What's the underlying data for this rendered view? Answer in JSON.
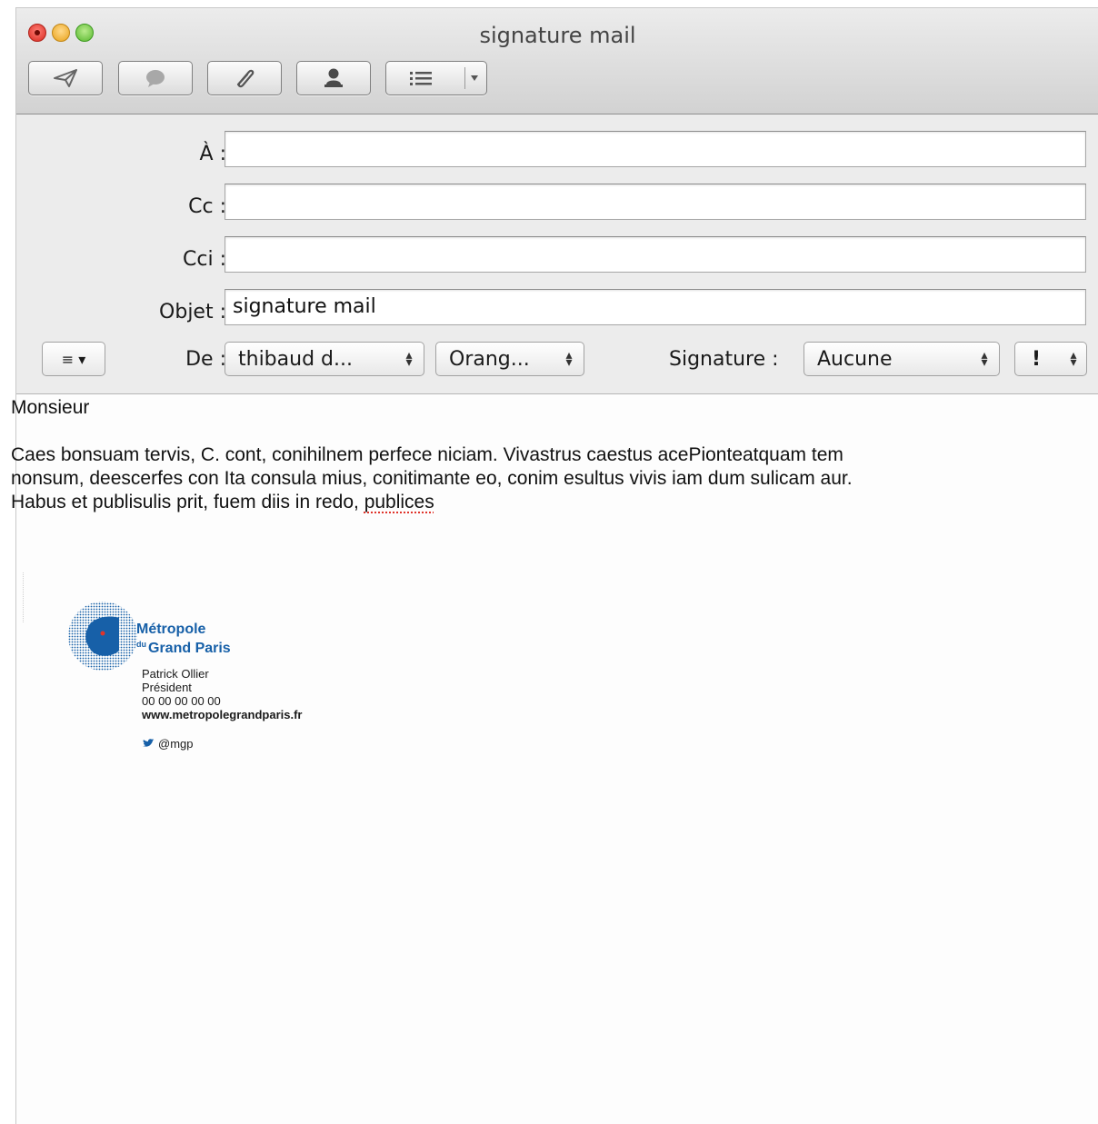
{
  "window": {
    "title": "signature mail"
  },
  "toolbar": {
    "buttons": [
      {
        "icon": "send-icon"
      },
      {
        "icon": "chat-icon"
      },
      {
        "icon": "paperclip-icon"
      },
      {
        "icon": "contact-icon"
      },
      {
        "icon": "list-format-icon"
      }
    ]
  },
  "header": {
    "to_label": "À :",
    "to_value": "",
    "cc_label": "Cc :",
    "cc_value": "",
    "bcc_label": "Cci :",
    "bcc_value": "",
    "subject_label": "Objet :",
    "subject_value": "signature mail",
    "from_label": "De :",
    "from_account": "thibaud d...",
    "from_server": "Orang...",
    "signature_label": "Signature :",
    "signature_value": "Aucune",
    "priority_value": "!",
    "header_menu_glyph": "≡ ▾"
  },
  "body": {
    "greeting": "Monsieur",
    "line1": "Caes bonsuam tervis, C. cont, conihilnem perfece niciam. Vivastrus caestus acePionteatquam tem",
    "line2": "nonsum, deescerfes con Ita consula mius, conitimante eo, conim esultus vivis iam dum sulicam aur.",
    "line3_start": "Habus et publisulis prit, fuem diis in redo, ",
    "line3_misspelled": "publices"
  },
  "signature": {
    "logo_line1": "Métropole",
    "logo_du": "du",
    "logo_line2": "Grand Paris",
    "name": "Patrick Ollier",
    "role": "Président",
    "phone": "00 00 00 00 00",
    "website": "www.metropolegrandparis.fr",
    "twitter": "@mgp",
    "brand_color": "#1760a8",
    "accent_color": "#e0342b"
  }
}
